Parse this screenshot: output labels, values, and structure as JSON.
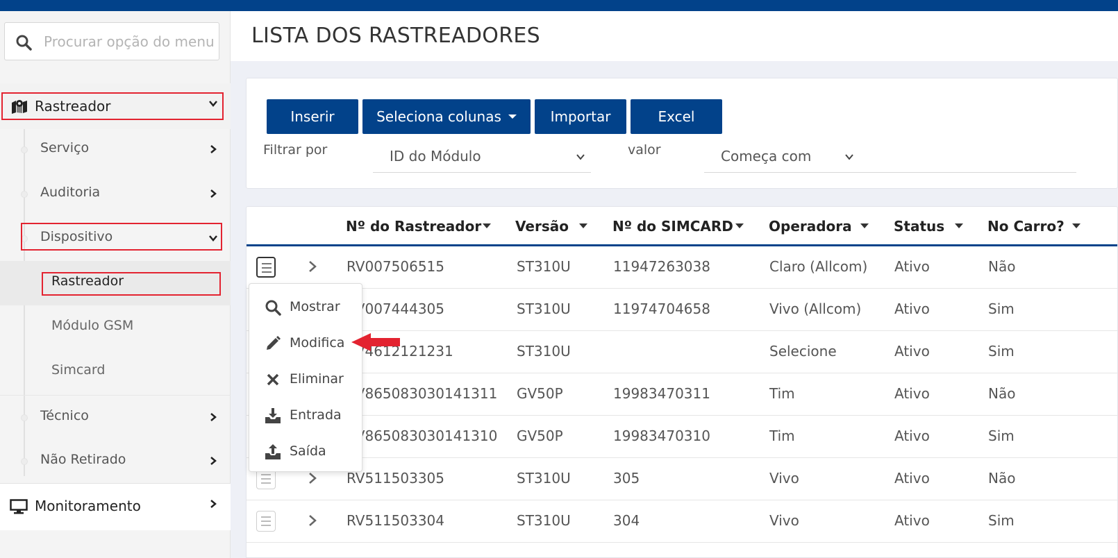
{
  "page_title": "LISTA DOS RASTREADORES",
  "search": {
    "placeholder": "Procurar opção do menu"
  },
  "sidebar": {
    "top_item": "Rastreador",
    "sub_items": [
      {
        "label": "Serviço"
      },
      {
        "label": "Auditoria"
      },
      {
        "label": "Dispositivo"
      }
    ],
    "device_children": [
      {
        "label": "Rastreador"
      },
      {
        "label": "Módulo GSM"
      },
      {
        "label": "Simcard"
      }
    ],
    "more_items": [
      {
        "label": "Técnico"
      },
      {
        "label": "Não Retirado"
      }
    ],
    "bottom_item": "Monitoramento"
  },
  "toolbar": {
    "insert": "Inserir",
    "columns": "Seleciona colunas",
    "import": "Importar",
    "excel": "Excel"
  },
  "filter": {
    "label": "Filtrar por",
    "field": "ID do Módulo",
    "value_label": "valor",
    "operator": "Começa com"
  },
  "table": {
    "headers": [
      "Nº do Rastreador",
      "Versão",
      "Nº do SIMCARD",
      "Operadora",
      "Status",
      "No Carro?"
    ],
    "rows": [
      [
        "RV007506515",
        "ST310U",
        "11947263038",
        "Claro (Allcom)",
        "Ativo",
        "Não"
      ],
      [
        "RV007444305",
        "ST310U",
        "11974704658",
        "Vivo (Allcom)",
        "Ativo",
        "Sim"
      ],
      [
        "RV4612121231",
        "ST310U",
        "",
        "Selecione",
        "Ativo",
        "Sim"
      ],
      [
        "RV865083030141311",
        "GV50P",
        "19983470311",
        "Tim",
        "Ativo",
        "Não"
      ],
      [
        "RV865083030141310",
        "GV50P",
        "19983470310",
        "Tim",
        "Ativo",
        "Sim"
      ],
      [
        "RV511503305",
        "ST310U",
        "305",
        "Vivo",
        "Ativo",
        "Não"
      ],
      [
        "RV511503304",
        "ST310U",
        "304",
        "Vivo",
        "Ativo",
        "Sim"
      ]
    ]
  },
  "row_menu": {
    "items": [
      {
        "label": "Mostrar",
        "icon": "search-icon"
      },
      {
        "label": "Modifica",
        "icon": "pencil-icon"
      },
      {
        "label": "Eliminar",
        "icon": "close-icon"
      },
      {
        "label": "Entrada",
        "icon": "download-tray-icon"
      },
      {
        "label": "Saída",
        "icon": "upload-tray-icon"
      }
    ]
  },
  "colors": {
    "brand": "#02428a",
    "highlight": "#e32330"
  }
}
